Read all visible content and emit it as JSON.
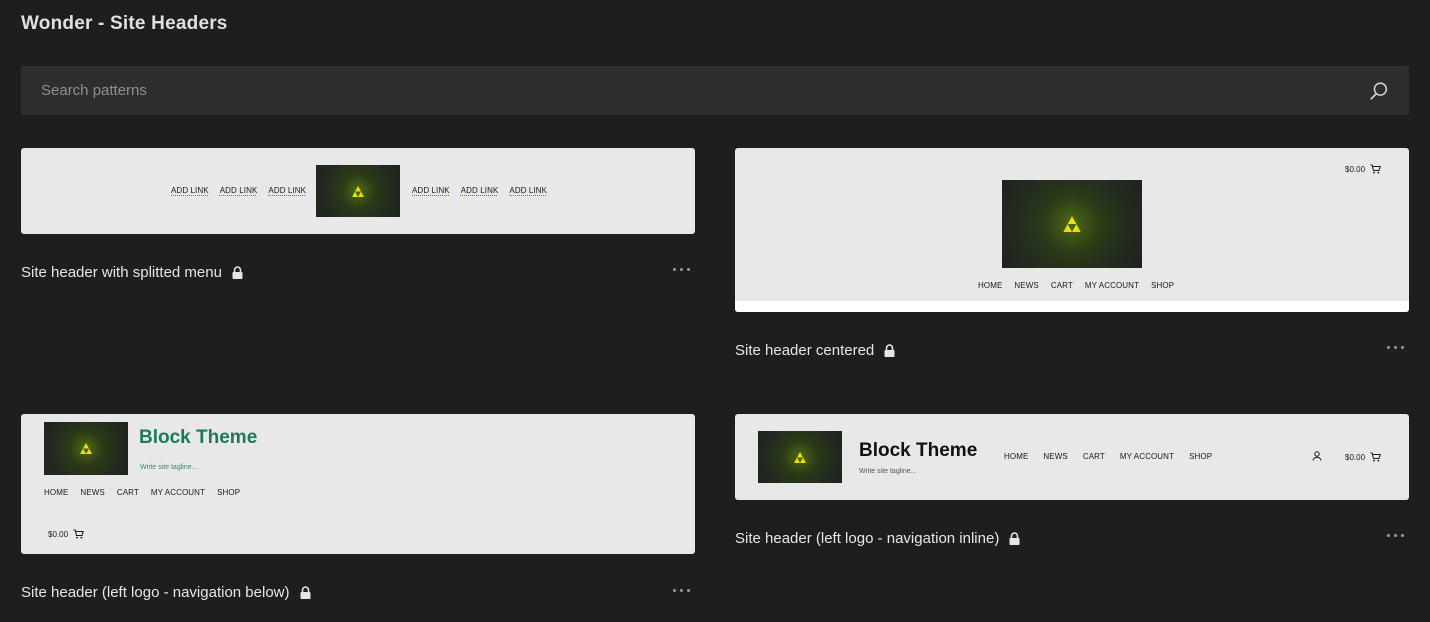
{
  "page": {
    "title": "Wonder - Site Headers"
  },
  "search": {
    "placeholder": "Search patterns"
  },
  "patterns": [
    {
      "label": "Site header with splitted menu",
      "links_left": [
        "ADD LINK",
        "ADD LINK",
        "ADD LINK"
      ],
      "links_right": [
        "ADD LINK",
        "ADD LINK",
        "ADD LINK"
      ]
    },
    {
      "label": "Site header centered",
      "cart": "$0.00",
      "nav": [
        "HOME",
        "NEWS",
        "CART",
        "MY ACCOUNT",
        "SHOP"
      ]
    },
    {
      "label": "Site header (left logo - navigation below)",
      "site_title": "Block Theme",
      "tagline": "Write site tagline...",
      "nav": [
        "HOME",
        "NEWS",
        "CART",
        "MY ACCOUNT",
        "SHOP"
      ],
      "cart": "$0.00"
    },
    {
      "label": "Site header (left logo - navigation inline)",
      "site_title": "Block Theme",
      "tagline": "Write site tagline...",
      "nav": [
        "HOME",
        "NEWS",
        "CART",
        "MY ACCOUNT",
        "SHOP"
      ],
      "cart": "$0.00"
    }
  ],
  "colors": {
    "background": "#1e1e1e",
    "search_bg": "#2e2e2e",
    "card_bg": "#e8e8e8",
    "accent_title": "#1b7a5c",
    "triforce": "#e8e000"
  }
}
